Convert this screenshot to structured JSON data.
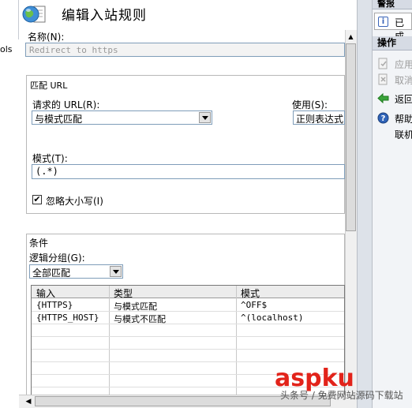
{
  "left_strip": {
    "text": "ols"
  },
  "header": {
    "title": "编辑入站规则",
    "icon": "globe-document-icon"
  },
  "name": {
    "label": "名称(N):",
    "value": "Redirect to https"
  },
  "match_url": {
    "group_title": "匹配 URL",
    "requested_url_label": "请求的 URL(R):",
    "requested_url_value": "与模式匹配",
    "using_label": "使用(S):",
    "using_value": "正则表达式",
    "pattern_label": "模式(T):",
    "pattern_value": "(.*)",
    "ignore_case_label": "忽略大小写(I)",
    "ignore_case_checked": "✔"
  },
  "conditions": {
    "group_title": "条件",
    "logical_grouping_label": "逻辑分组(G):",
    "logical_grouping_value": "全部匹配",
    "columns": [
      "输入",
      "类型",
      "模式"
    ],
    "rows": [
      [
        "{HTTPS}",
        "与模式匹配",
        "^OFF$"
      ],
      [
        "{HTTPS_HOST}",
        "与模式不匹配",
        "^(localhost)"
      ]
    ]
  },
  "right_panel": {
    "alerts_header": "警报",
    "alert_text": "已成",
    "actions_header": "操作",
    "actions": [
      {
        "label": "应用",
        "icon": "apply-icon",
        "enabled": false
      },
      {
        "label": "取消",
        "icon": "cancel-icon",
        "enabled": false
      },
      {
        "label": "返回",
        "icon": "back-arrow-icon",
        "enabled": true
      },
      {
        "label": "帮助",
        "icon": "help-icon",
        "enabled": true
      },
      {
        "label": "联机",
        "icon": "",
        "enabled": true
      }
    ]
  },
  "watermark": {
    "brand": "aspku",
    "sub": "头条号 / 免费网站源码下载站"
  },
  "colors": {
    "accent": "#3a64b8",
    "watermark": "#e2231a",
    "back_arrow": "#3aa33a"
  }
}
